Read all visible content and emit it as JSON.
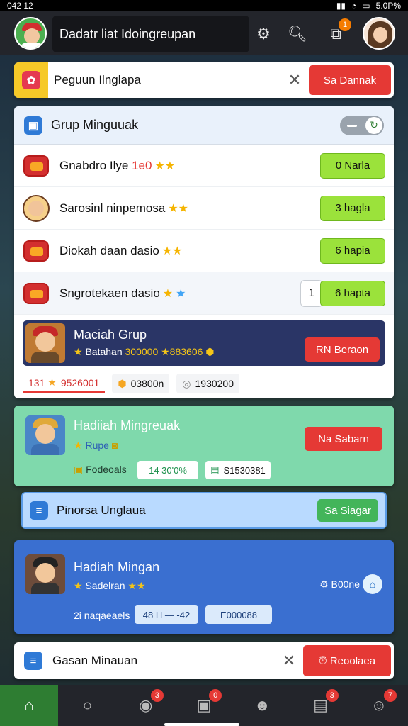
{
  "status": {
    "time": "042 12",
    "battery": "5.0P%"
  },
  "header": {
    "title": "Dadatr liat Idoingreupan",
    "notifications_badge": "1"
  },
  "banner_top": {
    "label": "Peguun Ilnglapa",
    "button": "Sa Dannak"
  },
  "group_panel": {
    "title": "Grup Minguuak",
    "rows": [
      {
        "label": "Gnabdro Ilye",
        "extra": "1e0",
        "stars": "★★",
        "button": "0 Narla"
      },
      {
        "label": "Sarosinl ninpemosa",
        "extra": "",
        "stars": "★★",
        "button": "3 hagla"
      },
      {
        "label": "Diokah daan dasio",
        "extra": "",
        "stars": "★★",
        "button": "6 hapia"
      },
      {
        "label": "Sngrotekaen dasio",
        "extra": "",
        "stars": "★",
        "input": "1",
        "button": "6 hapta"
      }
    ],
    "group_reward": {
      "title": "Maciah Grup",
      "subtitle_prefix": "Batahan",
      "subtitle_value": "300000 ★883606",
      "button": "RN Beraon"
    },
    "tabs": [
      {
        "count": "131",
        "value": "9526001"
      },
      {
        "value": "03800n"
      },
      {
        "value": "1930200"
      }
    ]
  },
  "green_card": {
    "title": "Hadiiah Mingreuak",
    "sub": "Rupe",
    "button": "Na Sabarn",
    "line_label": "Fodeoals",
    "pill1": "14 30'0%",
    "pill2": "S1530381"
  },
  "blue_bar": {
    "label": "Pinorsa Unglaua",
    "button": "Sa Siagar"
  },
  "blue_card": {
    "title": "Hadiah Mingan",
    "sub": "Sadelran",
    "side": "B00ne",
    "line_label": "2i naqaeaels",
    "pill1": "48 H — -42",
    "pill2": "E000088"
  },
  "banner_bottom": {
    "label": "Gasan Minauan",
    "button": "Reoolaea"
  },
  "bottom_nav": {
    "badges": [
      "3",
      "0",
      "3",
      "7"
    ]
  }
}
